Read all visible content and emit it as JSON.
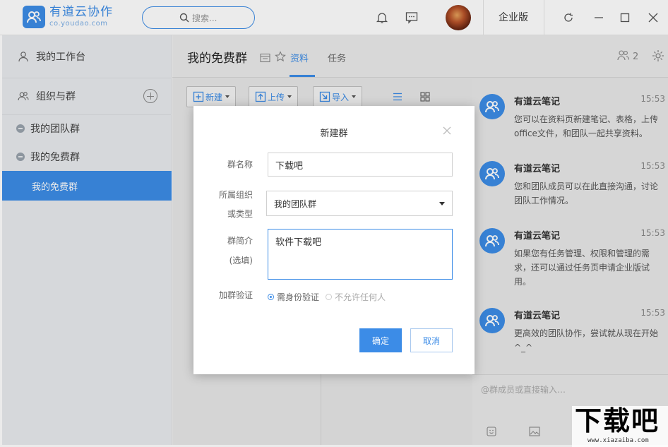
{
  "app": {
    "title": "有道云协作",
    "subtitle": "co.youdao.com",
    "search_placeholder": "搜索...",
    "edition": "企业版"
  },
  "sidebar": {
    "workspace": "我的工作台",
    "orgs": "组织与群",
    "items": [
      {
        "label": "我的团队群"
      },
      {
        "label": "我的免费群"
      },
      {
        "label": "我的免费群",
        "active": true
      }
    ]
  },
  "main": {
    "group_title": "我的免费群",
    "tabs": [
      {
        "label": "资料",
        "active": true
      },
      {
        "label": "任务"
      }
    ],
    "member_count": "2",
    "toolbar": {
      "new": "新建",
      "upload": "上传",
      "import": "导入"
    }
  },
  "chat": {
    "messages": [
      {
        "name": "有道云笔记",
        "time": "15:53",
        "text": "您可以在资料页新建笔记、表格，上传office文件，和团队一起共享资料。"
      },
      {
        "name": "有道云笔记",
        "time": "15:53",
        "text": "您和团队成员可以在此直接沟通，讨论团队工作情况。"
      },
      {
        "name": "有道云笔记",
        "time": "15:53",
        "text": "如果您有任务管理、权限和管理的需求，还可以通过任务页申请企业版试用。"
      },
      {
        "name": "有道云笔记",
        "time": "15:53",
        "text": "更高效的团队协作，尝试就从现在开始^_^"
      }
    ],
    "input_placeholder": "@群成员或直接输入…"
  },
  "modal": {
    "title": "新建群",
    "name_label": "群名称",
    "name_value": "下载吧",
    "org_label_1": "所属组织",
    "org_label_2": "或类型",
    "org_value": "我的团队群",
    "desc_label_1": "群简介",
    "desc_label_2": "(选填)",
    "desc_value": "软件下载吧",
    "verify_label": "加群验证",
    "verify_options": [
      {
        "label": "需身份验证",
        "selected": true
      },
      {
        "label": "不允许任何人",
        "selected": false
      }
    ],
    "confirm": "确定",
    "cancel": "取消"
  },
  "watermark": {
    "text": "下载吧",
    "url": "www.xiazaiba.com"
  },
  "colors": {
    "accent": "#3c8ce7",
    "sidebar_bg": "#e9ebee"
  }
}
